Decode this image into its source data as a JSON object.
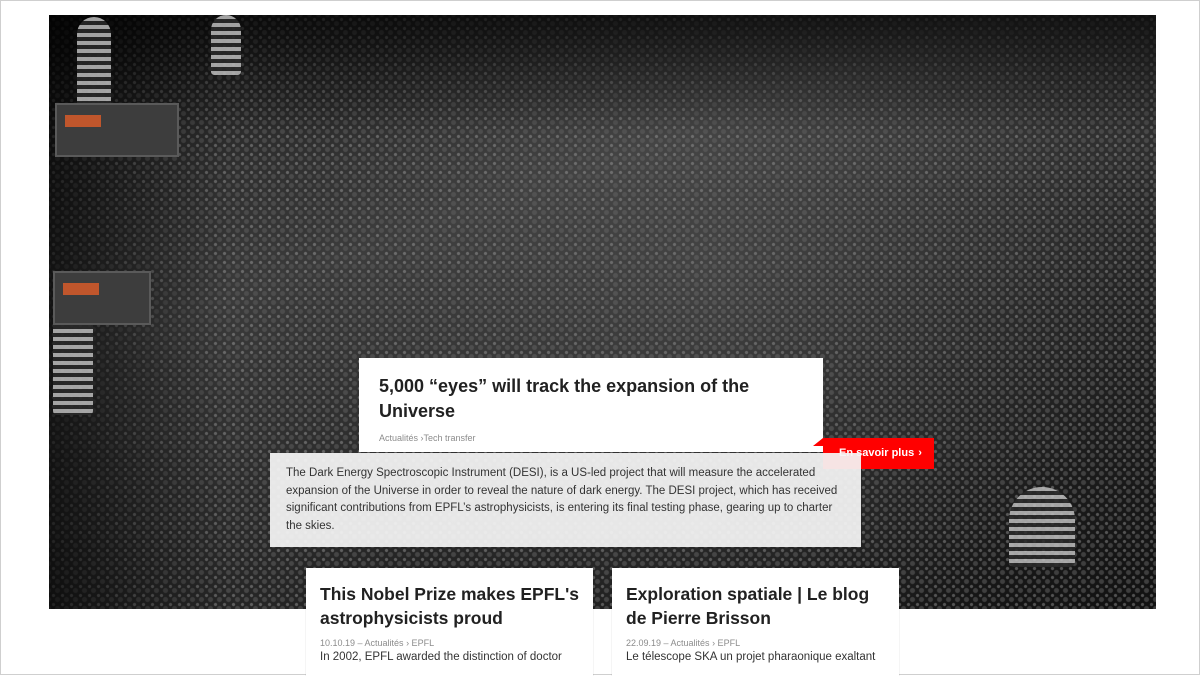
{
  "feature": {
    "title": "5,000 “eyes” will track the expansion of the Universe",
    "categories": "Actualités ›Tech transfer",
    "more_label": "En savoir plus",
    "summary": "The Dark Energy Spectroscopic Instrument (DESI), is a US-led project that will measure the accelerated expansion of the Universe in order to reveal the nature of dark energy. The DESI project, which has received significant contributions from EPFL’s astrophysicists, is entering its final testing phase, gearing up to charter the skies.",
    "accent_color": "#ff0000"
  },
  "cards": [
    {
      "title": "This Nobel Prize makes EPFL's astrophysicists proud",
      "meta": "10.10.19 – Actualités › EPFL",
      "excerpt": "In 2002, EPFL awarded the distinction of doctor"
    },
    {
      "title": "Exploration spatiale | Le blog de Pierre Brisson",
      "meta": "22.09.19 – Actualités › EPFL",
      "excerpt": "Le télescope SKA un projet pharaonique exaltant"
    }
  ],
  "icons": {
    "more_chevron": "chevron-right-icon"
  }
}
